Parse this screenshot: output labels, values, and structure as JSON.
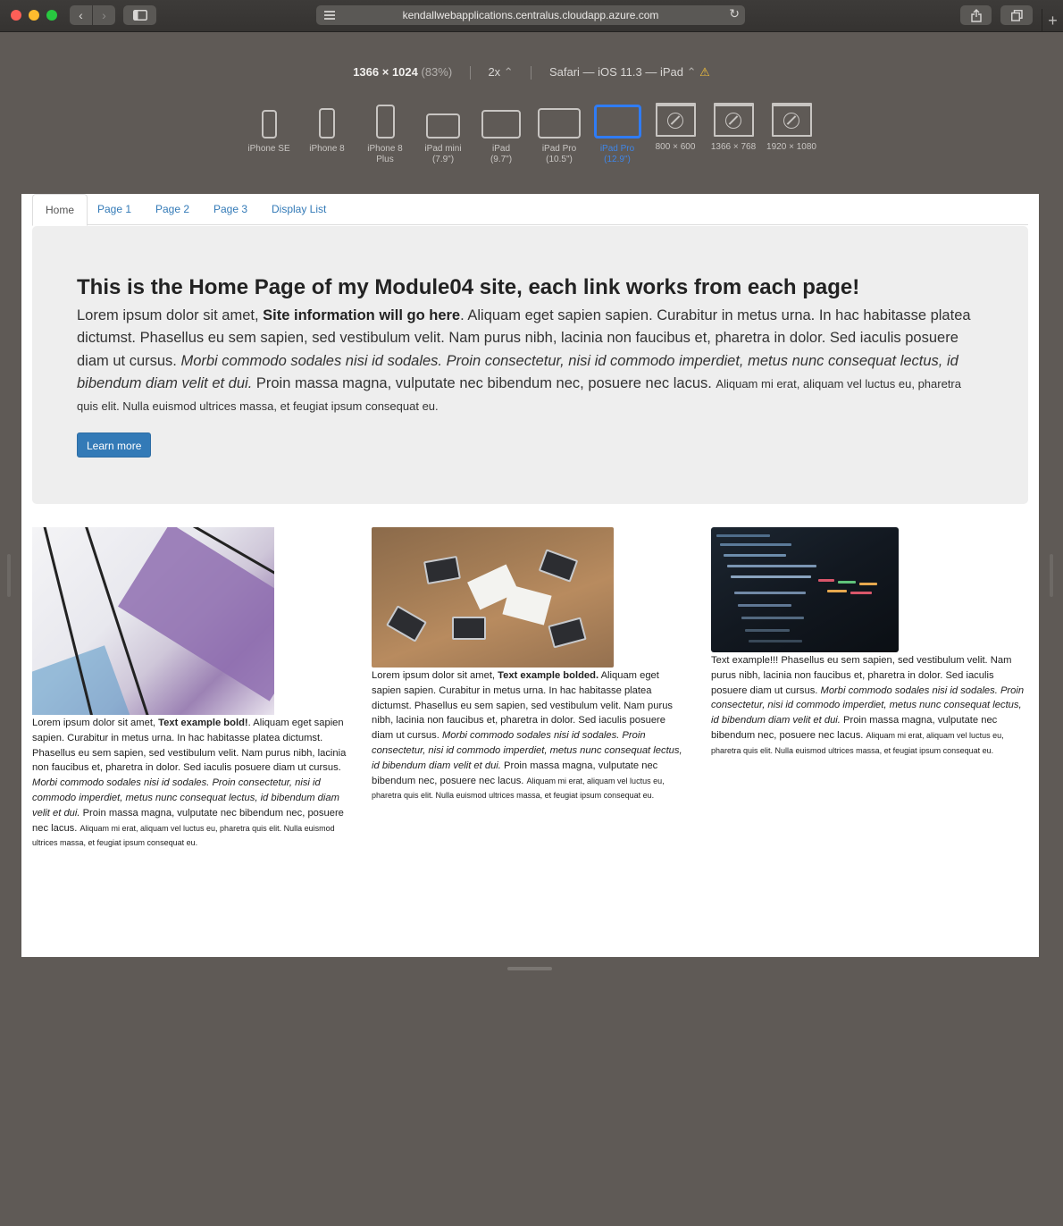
{
  "browser": {
    "url": "kendallwebapplications.centralus.cloudapp.azure.com",
    "back_icon": "‹",
    "forward_icon": "›",
    "reload_icon": "↻",
    "new_tab_icon": "+"
  },
  "rdm": {
    "width": "1366",
    "times": "×",
    "height": "1024",
    "zoom": "(83%)",
    "scale": "2x",
    "scale_caret": "⌃",
    "user_agent": "Safari — iOS 11.3 — iPad",
    "ua_caret": "⌃",
    "warning_icon": "⚠",
    "devices": [
      {
        "label": "iPhone SE"
      },
      {
        "label": "iPhone 8"
      },
      {
        "label": "iPhone 8",
        "label2": "Plus"
      },
      {
        "label": "iPad mini",
        "label2": "(7.9\")"
      },
      {
        "label": "iPad",
        "label2": "(9.7\")"
      },
      {
        "label": "iPad Pro",
        "label2": "(10.5\")"
      },
      {
        "label": "iPad Pro",
        "label2": "(12.9\")",
        "selected": true
      },
      {
        "label": "800 × 600"
      },
      {
        "label": "1366 × 768"
      },
      {
        "label": "1920 × 1080"
      }
    ],
    "accent": "#2f7cf5"
  },
  "site": {
    "nav": [
      {
        "label": "Home",
        "active": true
      },
      {
        "label": "Page 1"
      },
      {
        "label": "Page 2"
      },
      {
        "label": "Page 3"
      },
      {
        "label": "Display List"
      }
    ],
    "jumbotron": {
      "heading": "This is the Home Page of my Module04 site, each link works from each page!",
      "p1": "Lorem ipsum dolor sit amet, ",
      "p1_bold": "Site information will go here",
      "p2": ". Aliquam eget sapien sapien. Curabitur in metus urna. In hac habitasse platea dictumst. Phasellus eu sem sapien, sed vestibulum velit. Nam purus nibh, lacinia non faucibus et, pharetra in dolor. Sed iaculis posuere diam ut cursus. ",
      "p3_italic": "Morbi commodo sodales nisi id sodales. Proin consectetur, nisi id commodo imperdiet, metus nunc consequat lectus, id bibendum diam velit et dui.",
      "p4": " Proin massa magna, vulputate nec bibendum nec, posuere nec lacus. ",
      "p5_small": "Aliquam mi erat, aliquam vel luctus eu, pharetra quis elit. Nulla euismod ultrices massa, et feugiat ipsum consequat eu.",
      "button": "Learn more",
      "button_color": "#337ab7"
    },
    "columns": [
      {
        "t1": "Lorem ipsum dolor sit amet, ",
        "bold": "Text example bold!",
        "t2": ". Aliquam eget sapien sapien. Curabitur in metus urna. In hac habitasse platea dictumst. Phasellus eu sem sapien, sed vestibulum velit. Nam purus nibh, lacinia non faucibus et, pharetra in dolor. Sed iaculis posuere diam ut cursus. ",
        "italic": "Morbi commodo sodales nisi id sodales. Proin consectetur, nisi id commodo imperdiet, metus nunc consequat lectus, id bibendum diam velit et dui.",
        "t3": " Proin massa magna, vulputate nec bibendum nec, posuere nec lacus. ",
        "small": "Aliquam mi erat, aliquam vel luctus eu, pharetra quis elit. Nulla euismod ultrices massa, et feugiat ipsum consequat eu."
      },
      {
        "t1": "Lorem ipsum dolor sit amet, ",
        "bold": "Text example bolded.",
        "t2": " Aliquam eget sapien sapien. Curabitur in metus urna. In hac habitasse platea dictumst. Phasellus eu sem sapien, sed vestibulum velit. Nam purus nibh, lacinia non faucibus et, pharetra in dolor. Sed iaculis posuere diam ut cursus. ",
        "italic": "Morbi commodo sodales nisi id sodales. Proin consectetur, nisi id commodo imperdiet, metus nunc consequat lectus, id bibendum diam velit et dui.",
        "t3": " Proin massa magna, vulputate nec bibendum nec, posuere nec lacus. ",
        "small": "Aliquam mi erat, aliquam vel luctus eu, pharetra quis elit. Nulla euismod ultrices massa, et feugiat ipsum consequat eu."
      },
      {
        "t1": "Text example!!! Phasellus eu sem sapien, sed vestibulum velit. Nam purus nibh, lacinia non faucibus et, pharetra in dolor. Sed iaculis posuere diam ut cursus. ",
        "italic": "Morbi commodo sodales nisi id sodales. Proin consectetur, nisi id commodo imperdiet, metus nunc consequat lectus, id bibendum diam velit et dui.",
        "t3": " Proin massa magna, vulputate nec bibendum nec, posuere nec lacus. ",
        "small": "Aliquam mi erat, aliquam vel luctus eu, pharetra quis elit. Nulla euismod ultrices massa, et feugiat ipsum consequat eu."
      }
    ]
  }
}
